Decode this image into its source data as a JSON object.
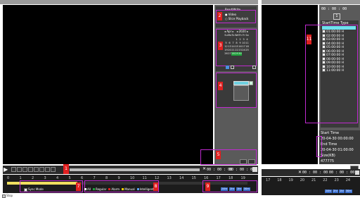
{
  "left": {
    "read_write": "Read/Write",
    "radio_video": "Video",
    "radio_slice": "Slice Playback",
    "calendar": {
      "month": "Apr",
      "year": "2020",
      "weekdays": [
        "Su",
        "Mo",
        "Tu",
        "We",
        "Th",
        "Fr",
        "Sa"
      ],
      "days": [
        "",
        "",
        "",
        "1",
        "2",
        "3",
        "4",
        "5",
        "6",
        "7",
        "8",
        "9",
        "10",
        "11",
        "12",
        "13",
        "14",
        "15",
        "16",
        "17",
        "18",
        "19",
        "20",
        "21",
        "22",
        "23",
        "24",
        "25",
        "26",
        "27",
        "28",
        "29",
        "30",
        "",
        ""
      ],
      "highlight": [
        "28",
        "29",
        "30"
      ]
    },
    "time_from": "00 : 00 : 00",
    "time_to": "00 : 00 : 00",
    "sync_mode": "Sync Mode",
    "stop": "Stop",
    "ticks": [
      "0",
      "1",
      "2",
      "3",
      "4",
      "5",
      "6",
      "7",
      "8",
      "9",
      "10",
      "11",
      "12",
      "13",
      "14",
      "15",
      "16",
      "17",
      "18",
      "19"
    ],
    "legend": [
      {
        "label": "All",
        "color": "#ffffff"
      },
      {
        "label": "Regular",
        "color": "#1da33b"
      },
      {
        "label": "Alarm",
        "color": "#e02020"
      },
      {
        "label": "Manual",
        "color": "#f0d000"
      },
      {
        "label": "Intelligent",
        "color": "#5aa0f0"
      }
    ],
    "zoom_labels": [
      "24hr",
      "2hr",
      "1hr",
      "30m"
    ]
  },
  "tags": [
    "1",
    "2",
    "3",
    "4",
    "5",
    "6",
    "7",
    "8",
    "9",
    "10"
  ],
  "right": {
    "time_top": "00 : 00 : 00",
    "box_top": "1",
    "list_header": "StartTime Type",
    "list_items": [
      "01:00:00",
      "02:00:00",
      "03:00:00",
      "04:00:00",
      "05:00:00",
      "06:00:00",
      "07:00:00",
      "08:00:00",
      "09:00:00",
      "10:00:00",
      "11:00:00"
    ],
    "list_item_type": "H",
    "tag": "11",
    "start_time_label": "Start Time",
    "start_time": "20-04-30 00:00:00",
    "end_time_label": "End Time",
    "end_time": "20-04-30 01:00:00",
    "size_label": "Size(KB)",
    "size_value": "477775",
    "time_from": "00 : 00 : 00",
    "time_to": "00 : 00 : 00",
    "ticks": [
      "17",
      "18",
      "19",
      "20",
      "21",
      "22",
      "23",
      "24"
    ],
    "zoom_labels": [
      "24hr",
      "2hr",
      "1hr",
      "30m"
    ]
  }
}
